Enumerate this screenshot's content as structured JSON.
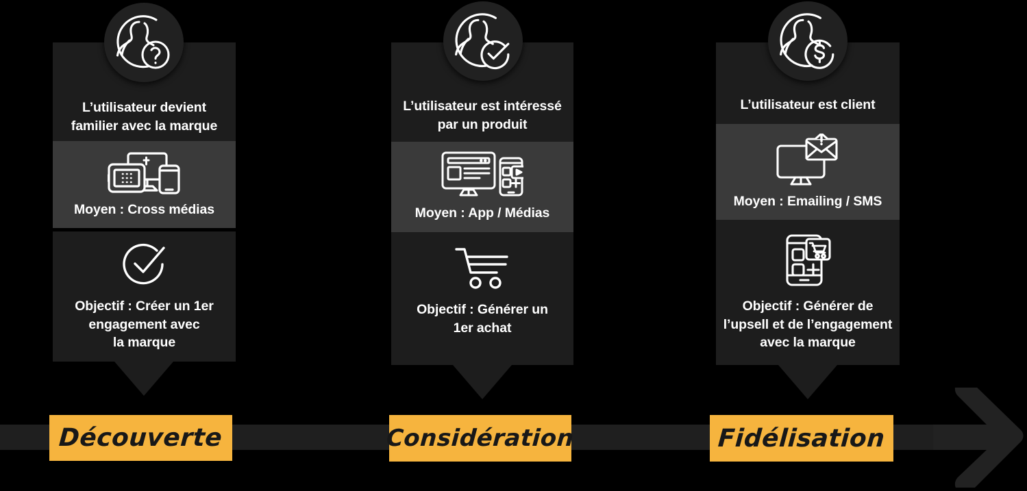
{
  "diagram": {
    "title": "Parcours client - Decouverte / Consideration / Fidelisation",
    "colors": {
      "background": "#000000",
      "card_dark": "#1d1d1d",
      "card_light": "#3a3a3a",
      "accent_yellow": "#f6b43e",
      "bar_gray": "#1f1f1f",
      "text_white": "#ffffff",
      "text_dark": "#181818"
    }
  },
  "columns": [
    {
      "id": "decouverte",
      "avatar_icon": "user-question-icon",
      "state": {
        "text": "L’utilisateur devient\nfamilier avec la marque"
      },
      "means": {
        "icon": "cross-media-devices-icon",
        "text": "Moyen : Cross médias"
      },
      "goal": {
        "icon": "check-circle-icon",
        "text": "Objectif : Créer un 1er\nengagement avec\nla marque"
      },
      "stage_label": "Découverte"
    },
    {
      "id": "consideration",
      "avatar_icon": "user-check-icon",
      "state": {
        "text": "L’utilisateur est intéressé\npar un produit"
      },
      "means": {
        "icon": "desktop-mobile-media-icon",
        "text": "Moyen :  App / Médias"
      },
      "goal": {
        "icon": "shopping-cart-icon",
        "text": "Objectif : Générer un\n1er achat"
      },
      "stage_label": "Considération"
    },
    {
      "id": "fidelisation",
      "avatar_icon": "user-dollar-icon",
      "state": {
        "text": "L’utilisateur est client"
      },
      "means": {
        "icon": "desktop-email-icon",
        "text": "Moyen :  Emailing  / SMS"
      },
      "goal": {
        "icon": "mobile-shopping-icon",
        "text": "Objectif : Générer de\nl’upsell et de l’engagement\navec la marque"
      },
      "stage_label": "Fidélisation"
    }
  ],
  "timeline": {
    "arrow_icon": "right-arrow-icon"
  }
}
